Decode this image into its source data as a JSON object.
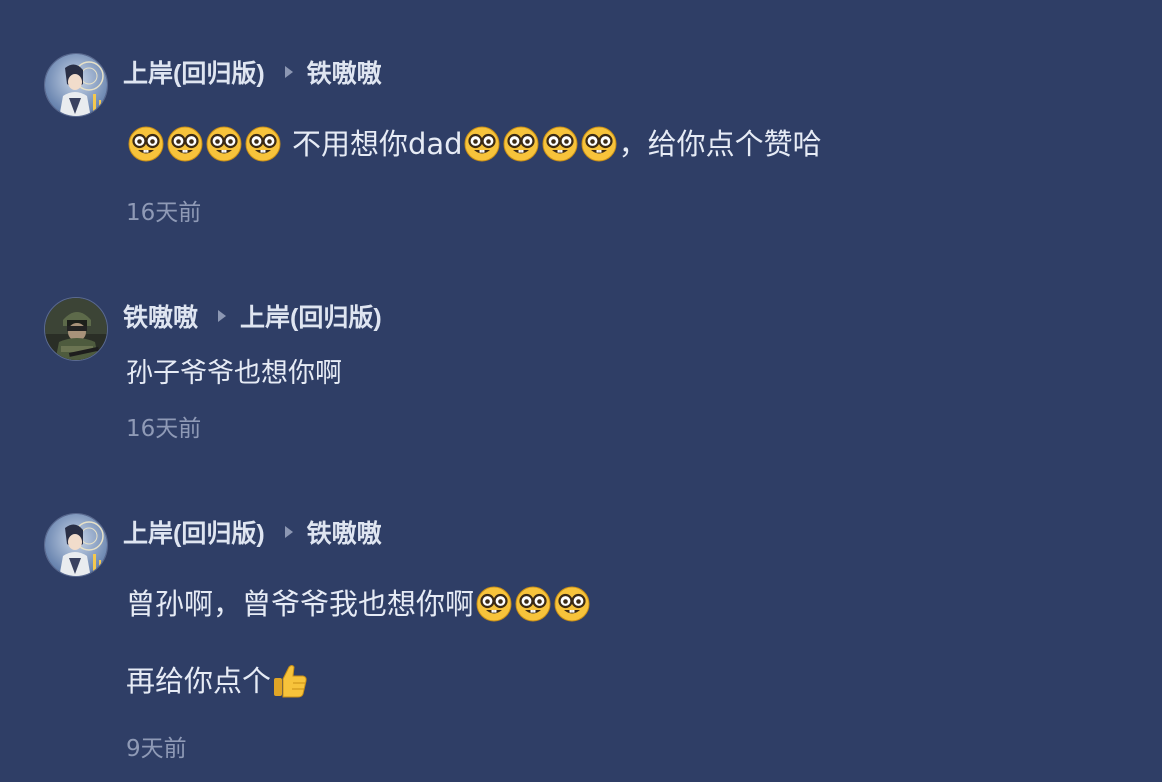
{
  "colors": {
    "background": "#2f3e66",
    "username": "#dfe5f1",
    "text": "#e6ebf5",
    "timestamp": "#8f9ab6",
    "emoji_face": "#f7c33b"
  },
  "comments": [
    {
      "author": "上岸(回归版)",
      "reply_to": "铁嗷嗷",
      "avatar_icon": "anime-avatar-icon",
      "text_before": "不用想你dad",
      "text_after": "，给你点个赞哈",
      "time": "16天前"
    },
    {
      "author": "铁嗷嗷",
      "reply_to": "上岸(回归版)",
      "avatar_icon": "soldier-avatar-icon",
      "text": "孙子爷爷也想你啊",
      "time": "16天前"
    },
    {
      "author": "上岸(回归版)",
      "reply_to": "铁嗷嗷",
      "avatar_icon": "anime-avatar-icon",
      "line1": "曾孙啊，曾爷爷我也想你啊",
      "line2": "再给你点个",
      "time": "9天前"
    }
  ]
}
